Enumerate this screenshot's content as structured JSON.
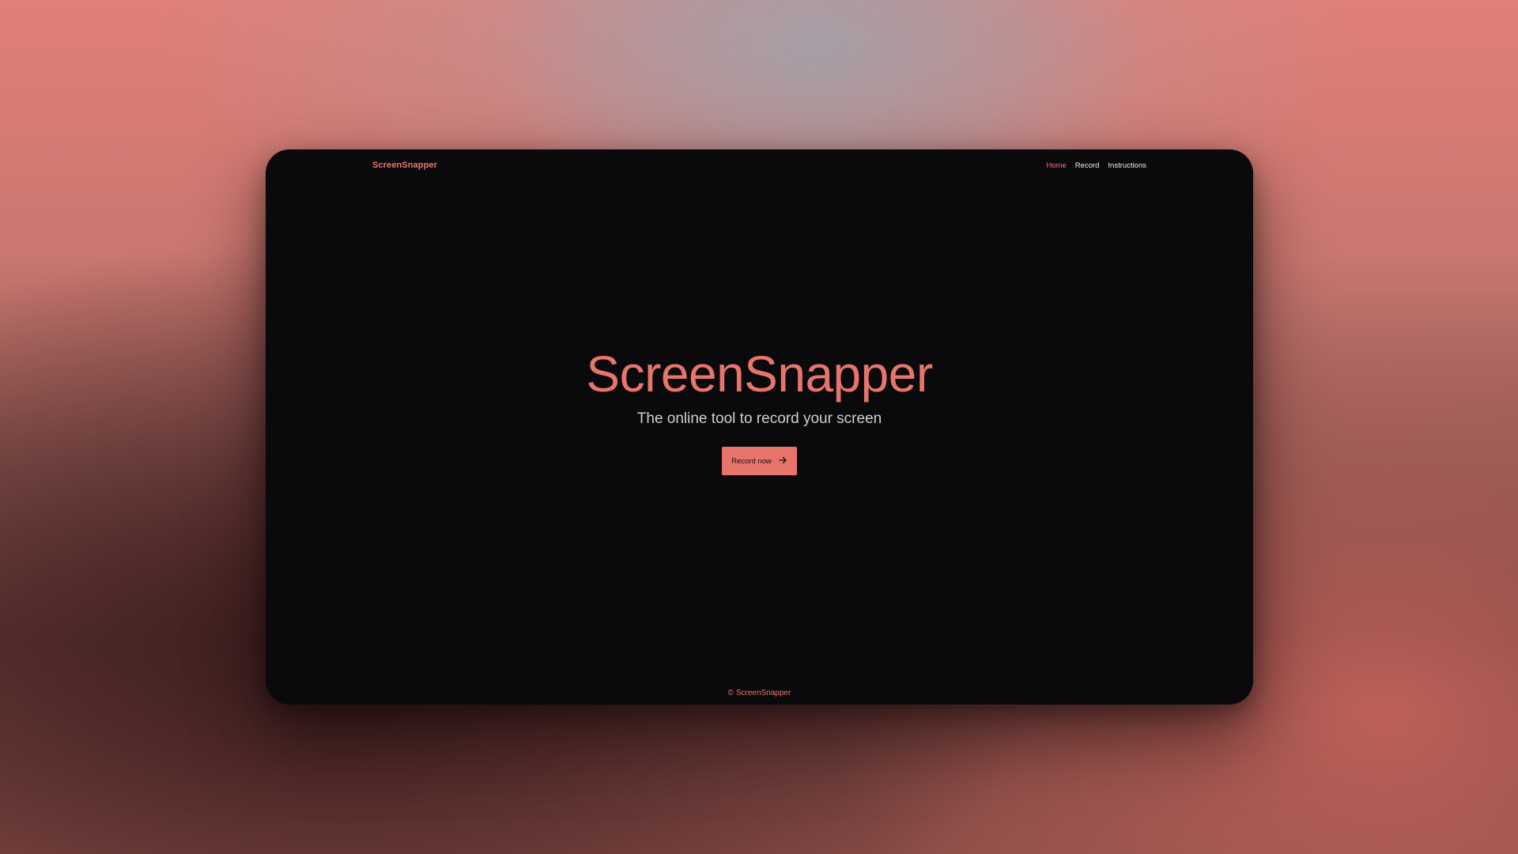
{
  "app": {
    "brand": "ScreenSnapper"
  },
  "nav": {
    "items": [
      {
        "label": "Home",
        "active": true
      },
      {
        "label": "Record",
        "active": false
      },
      {
        "label": "Instructions",
        "active": false
      }
    ]
  },
  "hero": {
    "title": "ScreenSnapper",
    "subtitle": "The online tool to record your screen",
    "cta_label": "Record now",
    "cta_icon": "arrow-right-icon"
  },
  "footer": {
    "copyright": "© ScreenSnapper"
  },
  "colors": {
    "accent": "#e8756c",
    "window_bg": "#0a0a0c",
    "text_light": "#f0f0f0",
    "text_muted": "#cfcfd2"
  }
}
